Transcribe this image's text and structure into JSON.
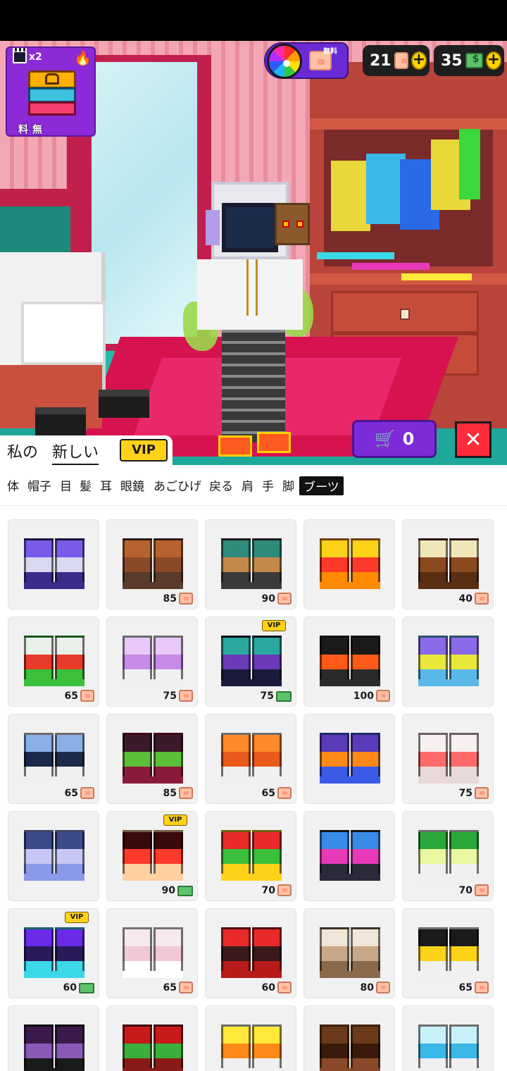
{
  "hud": {
    "chest_multiplier": "x2",
    "chest_free_label": "無料",
    "wheel_free_label": "無料",
    "pig_currency": "21",
    "cash_currency": "35",
    "cart_count": "0"
  },
  "tabs": {
    "mine": "私の",
    "new": "新しい",
    "vip": "VIP"
  },
  "categories": [
    "体",
    "帽子",
    "目",
    "髪",
    "耳",
    "眼鏡",
    "あごひげ",
    "戻る",
    "肩",
    "手",
    "脚",
    "ブーツ"
  ],
  "active_category": "ブーツ",
  "items": [
    {
      "price": "",
      "currency": "",
      "vip": false,
      "colors": [
        "#7a5ae8",
        "#d8d8f0",
        "#3a2a8a"
      ]
    },
    {
      "price": "85",
      "currency": "pig",
      "vip": false,
      "colors": [
        "#b8632e",
        "#8a4a2a",
        "#5a3a2a"
      ]
    },
    {
      "price": "90",
      "currency": "pig",
      "vip": false,
      "colors": [
        "#2f8a7a",
        "#c58a4a",
        "#3a3a3a"
      ]
    },
    {
      "price": "",
      "currency": "",
      "vip": false,
      "colors": [
        "#ffd21a",
        "#ff3a2a",
        "#ff8a00"
      ]
    },
    {
      "price": "40",
      "currency": "pig",
      "vip": false,
      "colors": [
        "#f0e6b8",
        "#8a4a1e",
        "#5a2e12"
      ]
    },
    {
      "price": "65",
      "currency": "pig",
      "vip": false,
      "colors": [
        "#e8f0e8",
        "#e83a2a",
        "#3ac03a"
      ]
    },
    {
      "price": "75",
      "currency": "pig",
      "vip": false,
      "colors": [
        "#e8c8f8",
        "#c88ae8",
        "#f0f0f0"
      ]
    },
    {
      "price": "75",
      "currency": "cash",
      "vip": true,
      "colors": [
        "#2aa8a0",
        "#6a3ab8",
        "#1a1a3a"
      ]
    },
    {
      "price": "100",
      "currency": "pig",
      "vip": false,
      "colors": [
        "#1a1a1a",
        "#ff5a1a",
        "#2a2a2a"
      ]
    },
    {
      "price": "",
      "currency": "",
      "vip": false,
      "colors": [
        "#8a6ae8",
        "#e8e83a",
        "#5ab8e8"
      ]
    },
    {
      "price": "65",
      "currency": "pig",
      "vip": false,
      "colors": [
        "#8ab0e8",
        "#1a2a4a",
        "#f0f0f0"
      ]
    },
    {
      "price": "85",
      "currency": "pig",
      "vip": false,
      "colors": [
        "#3a1a2a",
        "#5ac03a",
        "#8a1a3a"
      ]
    },
    {
      "price": "65",
      "currency": "pig",
      "vip": false,
      "colors": [
        "#ff8a2a",
        "#e85a1a",
        "#f0f0f0"
      ]
    },
    {
      "price": "",
      "currency": "",
      "vip": false,
      "colors": [
        "#5a3ab8",
        "#ff8a1a",
        "#3a5ae8"
      ]
    },
    {
      "price": "75",
      "currency": "pig",
      "vip": false,
      "colors": [
        "#f8f0f0",
        "#ff6a6a",
        "#e8d8d8"
      ]
    },
    {
      "price": "",
      "currency": "",
      "vip": false,
      "colors": [
        "#3a4a8a",
        "#c8c8f8",
        "#8a9ae8"
      ]
    },
    {
      "price": "90",
      "currency": "cash",
      "vip": true,
      "colors": [
        "#3a0a0a",
        "#ff3a2a",
        "#ffd0a0"
      ]
    },
    {
      "price": "70",
      "currency": "pig",
      "vip": false,
      "colors": [
        "#e82a2a",
        "#3ac03a",
        "#ffd21a"
      ]
    },
    {
      "price": "",
      "currency": "",
      "vip": false,
      "colors": [
        "#3a8ae8",
        "#e83ab8",
        "#2a2a3a"
      ]
    },
    {
      "price": "70",
      "currency": "pig",
      "vip": false,
      "colors": [
        "#2aa83a",
        "#e8f8a0",
        "#f0f0f0"
      ]
    },
    {
      "price": "60",
      "currency": "cash",
      "vip": true,
      "colors": [
        "#6a2ae8",
        "#2a1a5a",
        "#3ad8e8"
      ]
    },
    {
      "price": "65",
      "currency": "pig",
      "vip": false,
      "colors": [
        "#f8e8f0",
        "#f0c8d8",
        "#ffffff"
      ]
    },
    {
      "price": "60",
      "currency": "pig",
      "vip": false,
      "colors": [
        "#e82a2a",
        "#3a1a1a",
        "#b81a1a"
      ]
    },
    {
      "price": "80",
      "currency": "pig",
      "vip": false,
      "colors": [
        "#f0e6d8",
        "#c8a888",
        "#8a6a4a"
      ]
    },
    {
      "price": "65",
      "currency": "pig",
      "vip": false,
      "colors": [
        "#1a1a1a",
        "#ffd21a",
        "#f0f0f0"
      ]
    },
    {
      "price": "",
      "currency": "",
      "vip": false,
      "colors": [
        "#3a1a4a",
        "#8a5ab8",
        "#1a1a1a"
      ]
    },
    {
      "price": "",
      "currency": "",
      "vip": false,
      "colors": [
        "#c81a1a",
        "#3ab03a",
        "#8a1a1a"
      ]
    },
    {
      "price": "",
      "currency": "",
      "vip": false,
      "colors": [
        "#ffe83a",
        "#ff8a1a",
        "#f0f0f0"
      ]
    },
    {
      "price": "",
      "currency": "",
      "vip": false,
      "colors": [
        "#6a3a1a",
        "#3a1a0a",
        "#8a4a2a"
      ]
    },
    {
      "price": "",
      "currency": "",
      "vip": false,
      "colors": [
        "#c8f0f8",
        "#3ab8e8",
        "#f0f0f0"
      ]
    }
  ]
}
